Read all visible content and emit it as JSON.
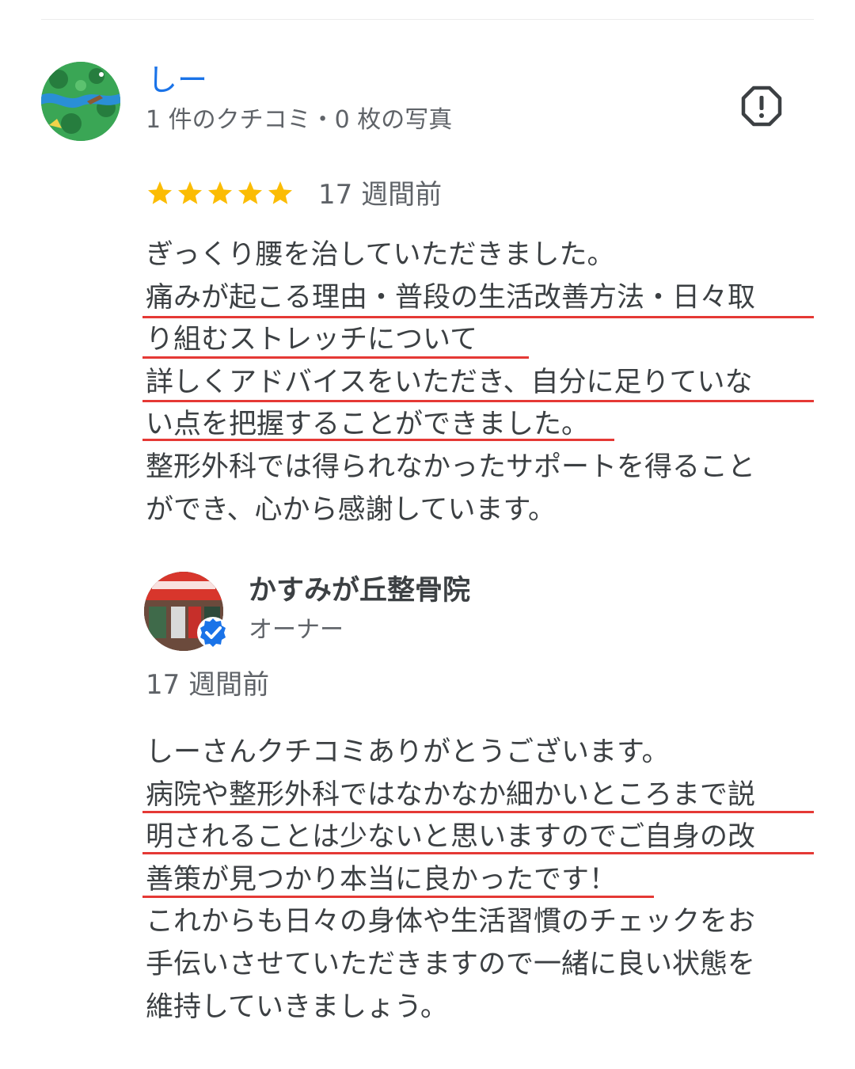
{
  "review": {
    "reviewer_name": "しー",
    "reviewer_meta": "1 件のクチコミ・0 枚の写真",
    "rating": 5,
    "time": "17 週間前",
    "text": "ぎっくり腰を治していただきました。\n痛みが起こる理由・普段の生活改善方法・日々取\nり組むストレッチについて\n詳しくアドバイスをいただき、自分に足りていな\nい点を把握することができました。\n整形外科では得られなかったサポートを得ること\nができ、心から感謝しています。",
    "flag_icon": "report-flag-icon",
    "star_color": "#fbbc04"
  },
  "reply": {
    "owner_name": "かすみが丘整骨院",
    "owner_role": "オーナー",
    "time": "17 週間前",
    "text": "しーさんクチコミありがとうございます。\n病院や整形外科ではなかなか細かいところまで説\n明されることは少ないと思いますのでご自身の改\n善策が見つかり本当に良かったです！\nこれからも日々の身体や生活習慣のチェックをお\n手伝いさせていただきますので一緒に良い状態を\n維持していきましょう。",
    "verified_icon": "verified-badge-icon"
  },
  "colors": {
    "name_link": "#1a73e8",
    "underline": "#e53935",
    "verified": "#1a73e8"
  }
}
